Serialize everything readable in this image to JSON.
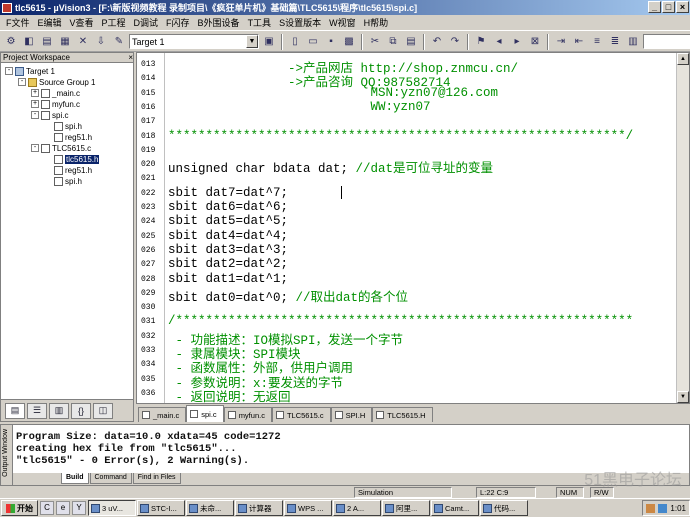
{
  "window": {
    "title": "tlc5615 - µVision3 - [F:\\新版视频教程 录制项目\\《疯狂单片机》基础篇\\TLC5615\\程序\\tlc5615\\spi.c]",
    "controls": [
      "_",
      "□",
      "×"
    ]
  },
  "menu": [
    "F文件",
    "E编辑",
    "V查看",
    "P工程",
    "D调试",
    "F闪存",
    "B外围设备",
    "T工具",
    "S设置版本",
    "W视窗",
    "H帮助"
  ],
  "toolbar": {
    "target_select": "Target 1",
    "find_select": ""
  },
  "workspace": {
    "title": "Project Workspace",
    "close": "×",
    "tree": [
      {
        "label": "Target 1",
        "level": 0,
        "type": "project",
        "expander": "-"
      },
      {
        "label": "Source Group 1",
        "level": 1,
        "type": "folder",
        "expander": "-"
      },
      {
        "label": "_main.c",
        "level": 2,
        "type": "file",
        "expander": "+"
      },
      {
        "label": "myfun.c",
        "level": 2,
        "type": "file",
        "expander": "+"
      },
      {
        "label": "spi.c",
        "level": 2,
        "type": "file",
        "expander": "-"
      },
      {
        "label": "spi.h",
        "level": 3,
        "type": "file",
        "expander": ""
      },
      {
        "label": "reg51.h",
        "level": 3,
        "type": "file",
        "expander": ""
      },
      {
        "label": "TLC5615.c",
        "level": 2,
        "type": "file",
        "expander": "-"
      },
      {
        "label": "tlc5615.h",
        "level": 3,
        "type": "file",
        "expander": "",
        "selected": true
      },
      {
        "label": "reg51.h",
        "level": 3,
        "type": "file",
        "expander": ""
      },
      {
        "label": "spi.h",
        "level": 3,
        "type": "file",
        "expander": ""
      }
    ]
  },
  "editor": {
    "lines": [
      {
        "num": "013",
        "text": "                ->产品网店 http://shop.znmcu.cn/",
        "color": "green"
      },
      {
        "num": "014",
        "text": "                ->产品咨询 QQ:987582714",
        "color": "green"
      },
      {
        "num": "015",
        "text": "                           MSN:yzn07@126.com",
        "color": "green"
      },
      {
        "num": "016",
        "text": "                           WW:yzn07",
        "color": "green"
      },
      {
        "num": "017",
        "text": "",
        "color": "black"
      },
      {
        "num": "018",
        "text": "*************************************************************/",
        "color": "green"
      },
      {
        "num": "019",
        "text": "",
        "color": "black"
      },
      {
        "num": "020",
        "text": "unsigned char bdata dat; //dat是可位寻址的变量",
        "color": "mixed"
      },
      {
        "num": "021",
        "text": "",
        "color": "black"
      },
      {
        "num": "022",
        "text": "sbit dat7=dat^7;",
        "color": "black"
      },
      {
        "num": "023",
        "text": "sbit dat6=dat^6;",
        "color": "black"
      },
      {
        "num": "024",
        "text": "sbit dat5=dat^5;",
        "color": "black"
      },
      {
        "num": "025",
        "text": "sbit dat4=dat^4;",
        "color": "black"
      },
      {
        "num": "026",
        "text": "sbit dat3=dat^3;",
        "color": "black"
      },
      {
        "num": "027",
        "text": "sbit dat2=dat^2;",
        "color": "black"
      },
      {
        "num": "028",
        "text": "sbit dat1=dat^1;",
        "color": "black"
      },
      {
        "num": "029",
        "text": "sbit dat0=dat^0; //取出dat的各个位",
        "color": "mixed"
      },
      {
        "num": "030",
        "text": "",
        "color": "black"
      },
      {
        "num": "031",
        "text": "/*************************************************************",
        "color": "green"
      },
      {
        "num": "032",
        "text": " - 功能描述：IO模拟SPI，发送一个字节",
        "color": "green"
      },
      {
        "num": "033",
        "text": " - 隶属模块：SPI模块",
        "color": "green"
      },
      {
        "num": "034",
        "text": " - 函数属性：外部，供用户调用",
        "color": "green"
      },
      {
        "num": "035",
        "text": " - 参数说明：x:要发送的字节",
        "color": "green"
      },
      {
        "num": "036",
        "text": " - 返回说明：无返回",
        "color": "green"
      }
    ],
    "tabs": [
      {
        "label": "_main.c",
        "active": false
      },
      {
        "label": "spi.c",
        "active": true
      },
      {
        "label": "myfun.c",
        "active": false
      },
      {
        "label": "TLC5615.c",
        "active": false
      },
      {
        "label": "SPI.H",
        "active": false
      },
      {
        "label": "TLC5615.H",
        "active": false
      }
    ]
  },
  "output": {
    "side_label": "Output Window",
    "lines": [
      "Program Size: data=10.0 xdata=45 code=1272",
      "creating hex file from \"tlc5615\"...",
      "\"tlc5615\" - 0 Error(s), 2 Warning(s)."
    ],
    "tabs": [
      {
        "label": "Build",
        "active": true
      },
      {
        "label": "Command",
        "active": false
      },
      {
        "label": "Find in Files",
        "active": false
      }
    ]
  },
  "status": {
    "mode": "Simulation",
    "position": "L:22 C:9",
    "num": "NUM",
    "rw": "R/W"
  },
  "taskbar": {
    "start": "开始",
    "quicklaunch": [
      "C",
      "e",
      "Y"
    ],
    "tasks": [
      "3 uV...",
      "STC-I...",
      "未命...",
      "计算器",
      "WPS ...",
      "2 A...",
      "阿里...",
      "Camt...",
      "代码..."
    ],
    "clock": "1:01"
  },
  "watermark": "51黑电子论坛"
}
